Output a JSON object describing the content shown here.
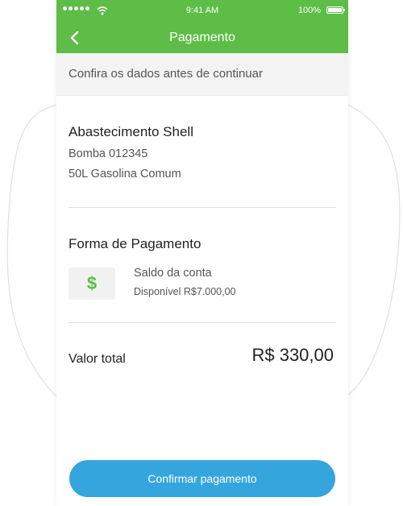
{
  "status_bar": {
    "time": "9:41 AM",
    "battery": "100%",
    "battery_level_percent": 100,
    "signal_dots": 5
  },
  "navbar": {
    "back_icon": "chevron-left-icon",
    "title": "Pagamento"
  },
  "subheader": {
    "text": "Confira os dados antes de continuar"
  },
  "station": {
    "title": "Abastecimento Shell",
    "pump": "Bomba 012345",
    "fuel": "50L Gasolina Comum"
  },
  "payment": {
    "section_title": "Forma de Pagamento",
    "icon": "dollar-icon",
    "icon_symbol": "$",
    "method": "Saldo da conta",
    "balance": "Disponível R$7.000,00"
  },
  "total": {
    "label": "Valor total",
    "value": "R$ 330,00"
  },
  "confirm_button": {
    "label": "Confirmar pagamento"
  },
  "colors": {
    "header_green": "#5dbd46",
    "button_blue": "#35a5dd",
    "dollar_green": "#5dbd46"
  }
}
